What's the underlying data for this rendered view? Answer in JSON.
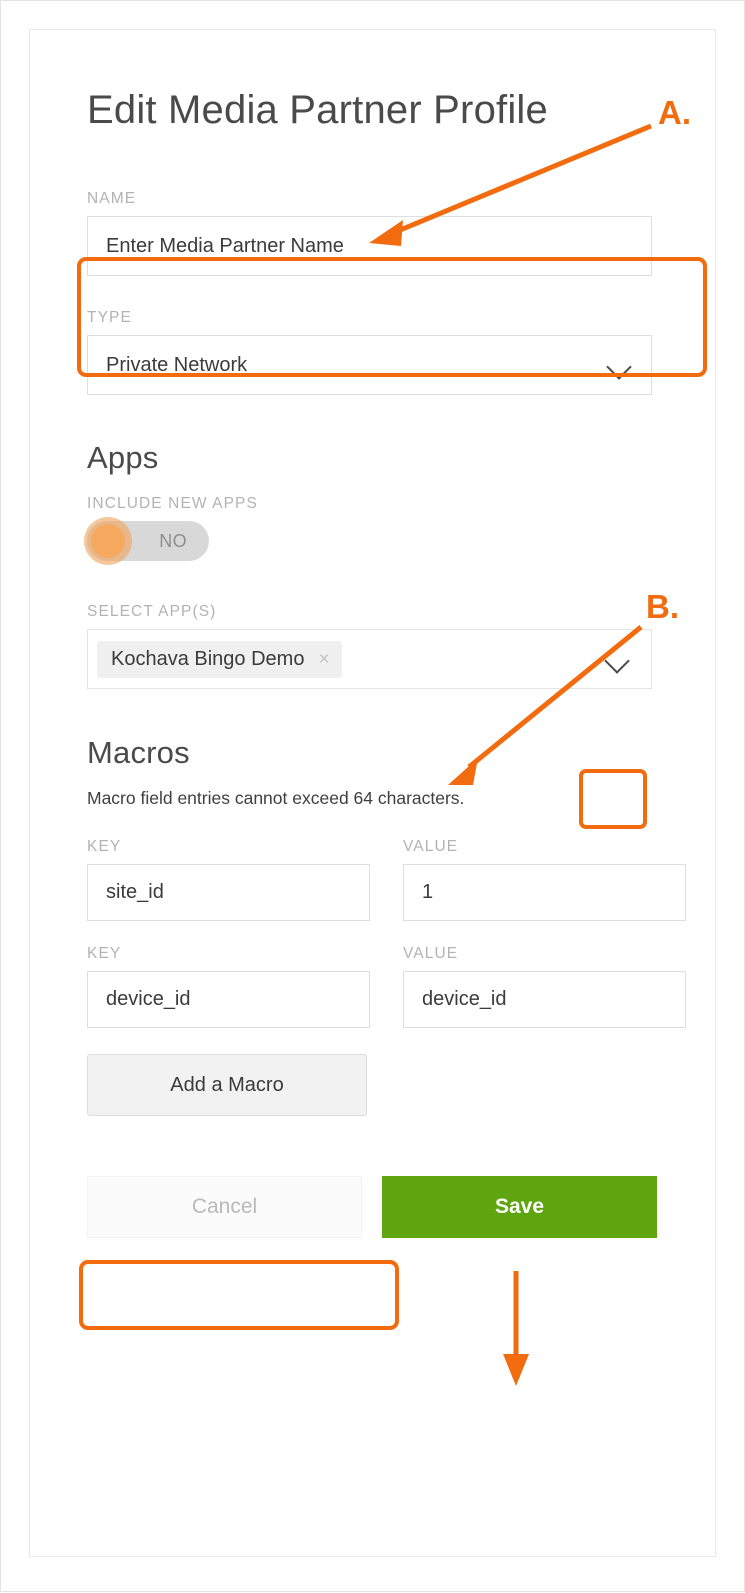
{
  "header": {
    "title": "Edit Media Partner Profile"
  },
  "name_field": {
    "label": "NAME",
    "value": "Enter Media Partner Name",
    "placeholder": "Enter Media Partner Name"
  },
  "type_field": {
    "label": "TYPE",
    "selected": "Private Network",
    "chevron_icon": "chevron-down-icon"
  },
  "apps_section": {
    "title": "Apps",
    "include_new_apps": {
      "label": "INCLUDE NEW APPS",
      "state_text": "NO",
      "enabled": false
    },
    "select_apps": {
      "label": "SELECT APP(S)",
      "chips": [
        {
          "text": "Kochava Bingo Demo",
          "remove_icon": "close-icon",
          "remove_glyph": "×"
        }
      ],
      "chevron_icon": "chevron-down-icon"
    }
  },
  "macros_section": {
    "title": "Macros",
    "helper_text": "Macro field entries cannot exceed 64 characters.",
    "key_label": "KEY",
    "value_label": "VALUE",
    "rows": [
      {
        "key": "site_id",
        "value": "1"
      },
      {
        "key": "device_id",
        "value": "device_id"
      }
    ],
    "add_button_label": "Add a Macro"
  },
  "actions": {
    "cancel_label": "Cancel",
    "save_label": "Save"
  },
  "annotations": [
    {
      "letter": "A."
    },
    {
      "letter": "B."
    }
  ],
  "colors": {
    "accent_orange": "#f26b0f",
    "save_green": "#5ea50f",
    "toggle_knob": "#f6a95f",
    "label_gray": "#b3b3b3"
  }
}
